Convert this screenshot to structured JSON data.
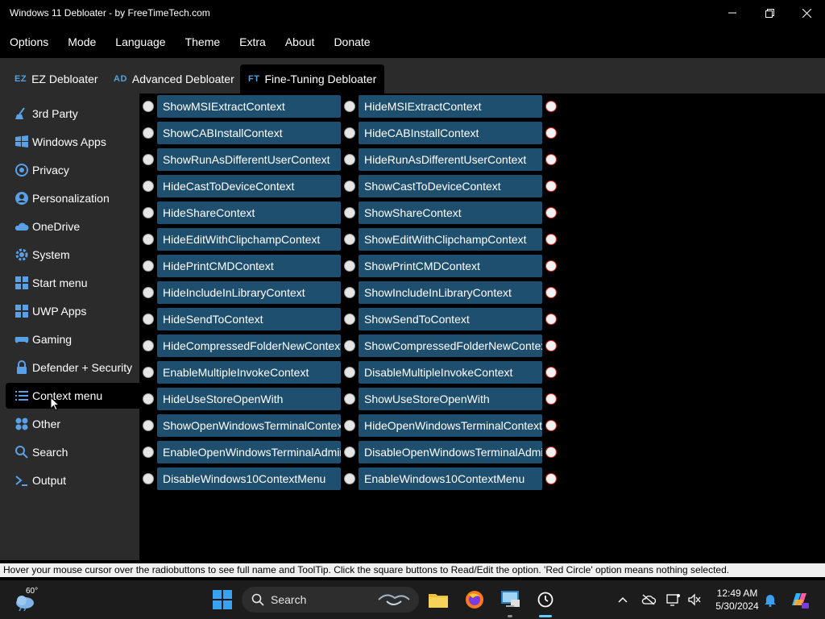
{
  "window": {
    "title": "Windows 11 Debloater - by FreeTimeTech.com"
  },
  "menu": [
    "Options",
    "Mode",
    "Language",
    "Theme",
    "Extra",
    "About",
    "Donate"
  ],
  "tabs": [
    {
      "abbr": "EZ",
      "label": "EZ Debloater",
      "active": false
    },
    {
      "abbr": "AD",
      "label": "Advanced Debloater",
      "active": false
    },
    {
      "abbr": "FT",
      "label": "Fine-Tuning Debloater",
      "active": true
    }
  ],
  "sidebar": [
    {
      "label": "3rd Party",
      "icon": "broom-icon"
    },
    {
      "label": "Windows Apps",
      "icon": "windows-logo-icon"
    },
    {
      "label": "Privacy",
      "icon": "privacy-icon"
    },
    {
      "label": "Personalization",
      "icon": "person-icon"
    },
    {
      "label": "OneDrive",
      "icon": "cloud-icon"
    },
    {
      "label": "System",
      "icon": "gear-icon"
    },
    {
      "label": "Start menu",
      "icon": "start-menu-icon"
    },
    {
      "label": "UWP Apps",
      "icon": "apps-grid-icon"
    },
    {
      "label": "Gaming",
      "icon": "gamepad-icon"
    },
    {
      "label": "Defender + Security",
      "icon": "lock-icon"
    },
    {
      "label": "Context menu",
      "icon": "list-icon",
      "active": true
    },
    {
      "label": "Other",
      "icon": "other-icon"
    },
    {
      "label": "Search",
      "icon": "search-icon"
    },
    {
      "label": "Output",
      "icon": "terminal-icon"
    }
  ],
  "options": [
    {
      "left": "ShowMSIExtractContext",
      "right": "HideMSIExtractContext"
    },
    {
      "left": "ShowCABInstallContext",
      "right": "HideCABInstallContext"
    },
    {
      "left": "ShowRunAsDifferentUserContext",
      "right": "HideRunAsDifferentUserContext"
    },
    {
      "left": "HideCastToDeviceContext",
      "right": "ShowCastToDeviceContext"
    },
    {
      "left": "HideShareContext",
      "right": "ShowShareContext"
    },
    {
      "left": "HideEditWithClipchampContext",
      "right": "ShowEditWithClipchampContext"
    },
    {
      "left": "HidePrintCMDContext",
      "right": "ShowPrintCMDContext"
    },
    {
      "left": "HideIncludeInLibraryContext",
      "right": "ShowIncludeInLibraryContext"
    },
    {
      "left": "HideSendToContext",
      "right": "ShowSendToContext"
    },
    {
      "left": "HideCompressedFolderNewContext",
      "right": "ShowCompressedFolderNewContext"
    },
    {
      "left": "EnableMultipleInvokeContext",
      "right": "DisableMultipleInvokeContext"
    },
    {
      "left": "HideUseStoreOpenWith",
      "right": "ShowUseStoreOpenWith"
    },
    {
      "left": "ShowOpenWindowsTerminalContext",
      "right": "HideOpenWindowsTerminalContext"
    },
    {
      "left": "EnableOpenWindowsTerminalAdminContext",
      "right": "DisableOpenWindowsTerminalAdminContext"
    },
    {
      "left": "DisableWindows10ContextMenu",
      "right": "EnableWindows10ContextMenu"
    }
  ],
  "status": "Hover your mouse cursor over the radiobuttons to see full name and ToolTip. Click the square buttons to Read/Edit the option. 'Red Circle' option means nothing selected.",
  "taskbar": {
    "weather_temp": "60°",
    "search_placeholder": "Search",
    "time": "12:49 AM",
    "date": "5/30/2024"
  },
  "colors": {
    "option_button": "#1f4f6e",
    "panel_gray": "#2b2b2b",
    "tab_abbr": "#4fa3e0",
    "red_circle": "#d93025"
  }
}
